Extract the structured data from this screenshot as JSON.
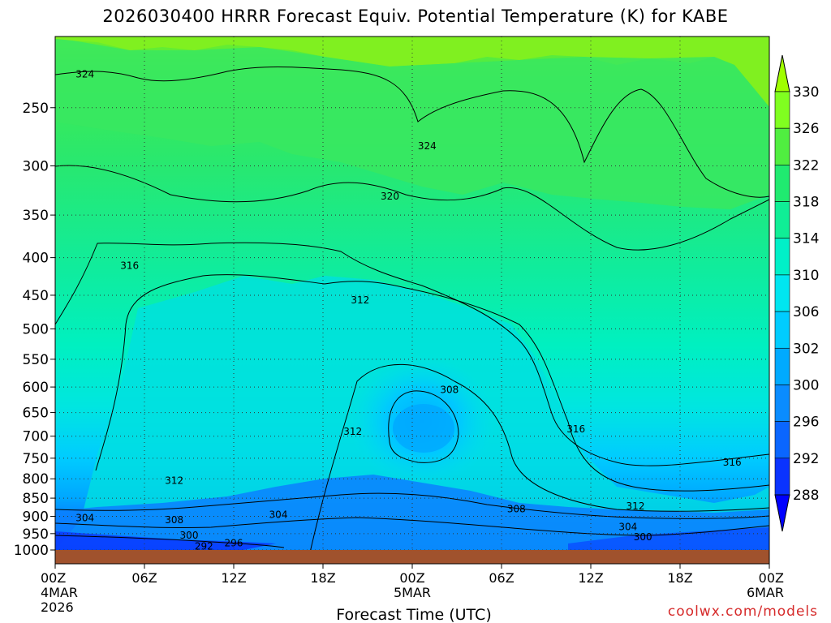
{
  "chart_data": {
    "type": "heatmap",
    "title": "2026030400 HRRR Forecast Equiv. Potential Temperature (K) for KABE",
    "xlabel": "Forecast Time (UTC)",
    "ylabel": "",
    "x_ticks": [
      {
        "hour": 0,
        "label": "00Z",
        "sub": "4MAR",
        "sub2": "2026"
      },
      {
        "hour": 6,
        "label": "06Z"
      },
      {
        "hour": 12,
        "label": "12Z"
      },
      {
        "hour": 18,
        "label": "18Z"
      },
      {
        "hour": 24,
        "label": "00Z",
        "sub": "5MAR"
      },
      {
        "hour": 30,
        "label": "06Z"
      },
      {
        "hour": 36,
        "label": "12Z"
      },
      {
        "hour": 42,
        "label": "18Z"
      },
      {
        "hour": 48,
        "label": "00Z",
        "sub": "6MAR"
      }
    ],
    "x_range": [
      0,
      48
    ],
    "y_ticks": [
      250,
      300,
      350,
      400,
      450,
      500,
      550,
      600,
      650,
      700,
      750,
      800,
      850,
      900,
      950,
      1000
    ],
    "y_range": [
      1000,
      200
    ],
    "y_scale": "log",
    "grid": true,
    "colorbar": {
      "levels": [
        288,
        292,
        296,
        300,
        302,
        306,
        310,
        314,
        318,
        322,
        326,
        330
      ],
      "colors": [
        "#0000ff",
        "#0a33ff",
        "#0a66ff",
        "#0a8cff",
        "#00aaff",
        "#00ccff",
        "#00e6f0",
        "#00f0c8",
        "#10ee96",
        "#20ea70",
        "#50ee40",
        "#80ff20",
        "#a0ff00"
      ]
    },
    "contour_labels": [
      {
        "value": "324",
        "hour": 2.0,
        "p": 225
      },
      {
        "value": "324",
        "hour": 25.0,
        "p": 282
      },
      {
        "value": "320",
        "hour": 22.5,
        "p": 330
      },
      {
        "value": "316",
        "hour": 5.0,
        "p": 410
      },
      {
        "value": "312",
        "hour": 20.5,
        "p": 457
      },
      {
        "value": "308",
        "hour": 26.5,
        "p": 605
      },
      {
        "value": "312",
        "hour": 20.0,
        "p": 690
      },
      {
        "value": "316",
        "hour": 35.0,
        "p": 685
      },
      {
        "value": "316",
        "hour": 45.5,
        "p": 760
      },
      {
        "value": "312",
        "hour": 8.0,
        "p": 805
      },
      {
        "value": "304",
        "hour": 15.0,
        "p": 895
      },
      {
        "value": "308",
        "hour": 31.0,
        "p": 880
      },
      {
        "value": "312",
        "hour": 39.0,
        "p": 872
      },
      {
        "value": "304",
        "hour": 2.0,
        "p": 905
      },
      {
        "value": "308",
        "hour": 8.0,
        "p": 910
      },
      {
        "value": "300",
        "hour": 9.0,
        "p": 955
      },
      {
        "value": "304",
        "hour": 38.5,
        "p": 930
      },
      {
        "value": "300",
        "hour": 39.5,
        "p": 960
      },
      {
        "value": "292",
        "hour": 10.0,
        "p": 988
      },
      {
        "value": "296",
        "hour": 12.0,
        "p": 978
      }
    ],
    "surface_color": "#a0522d"
  },
  "credit": "coolwx.com/models"
}
